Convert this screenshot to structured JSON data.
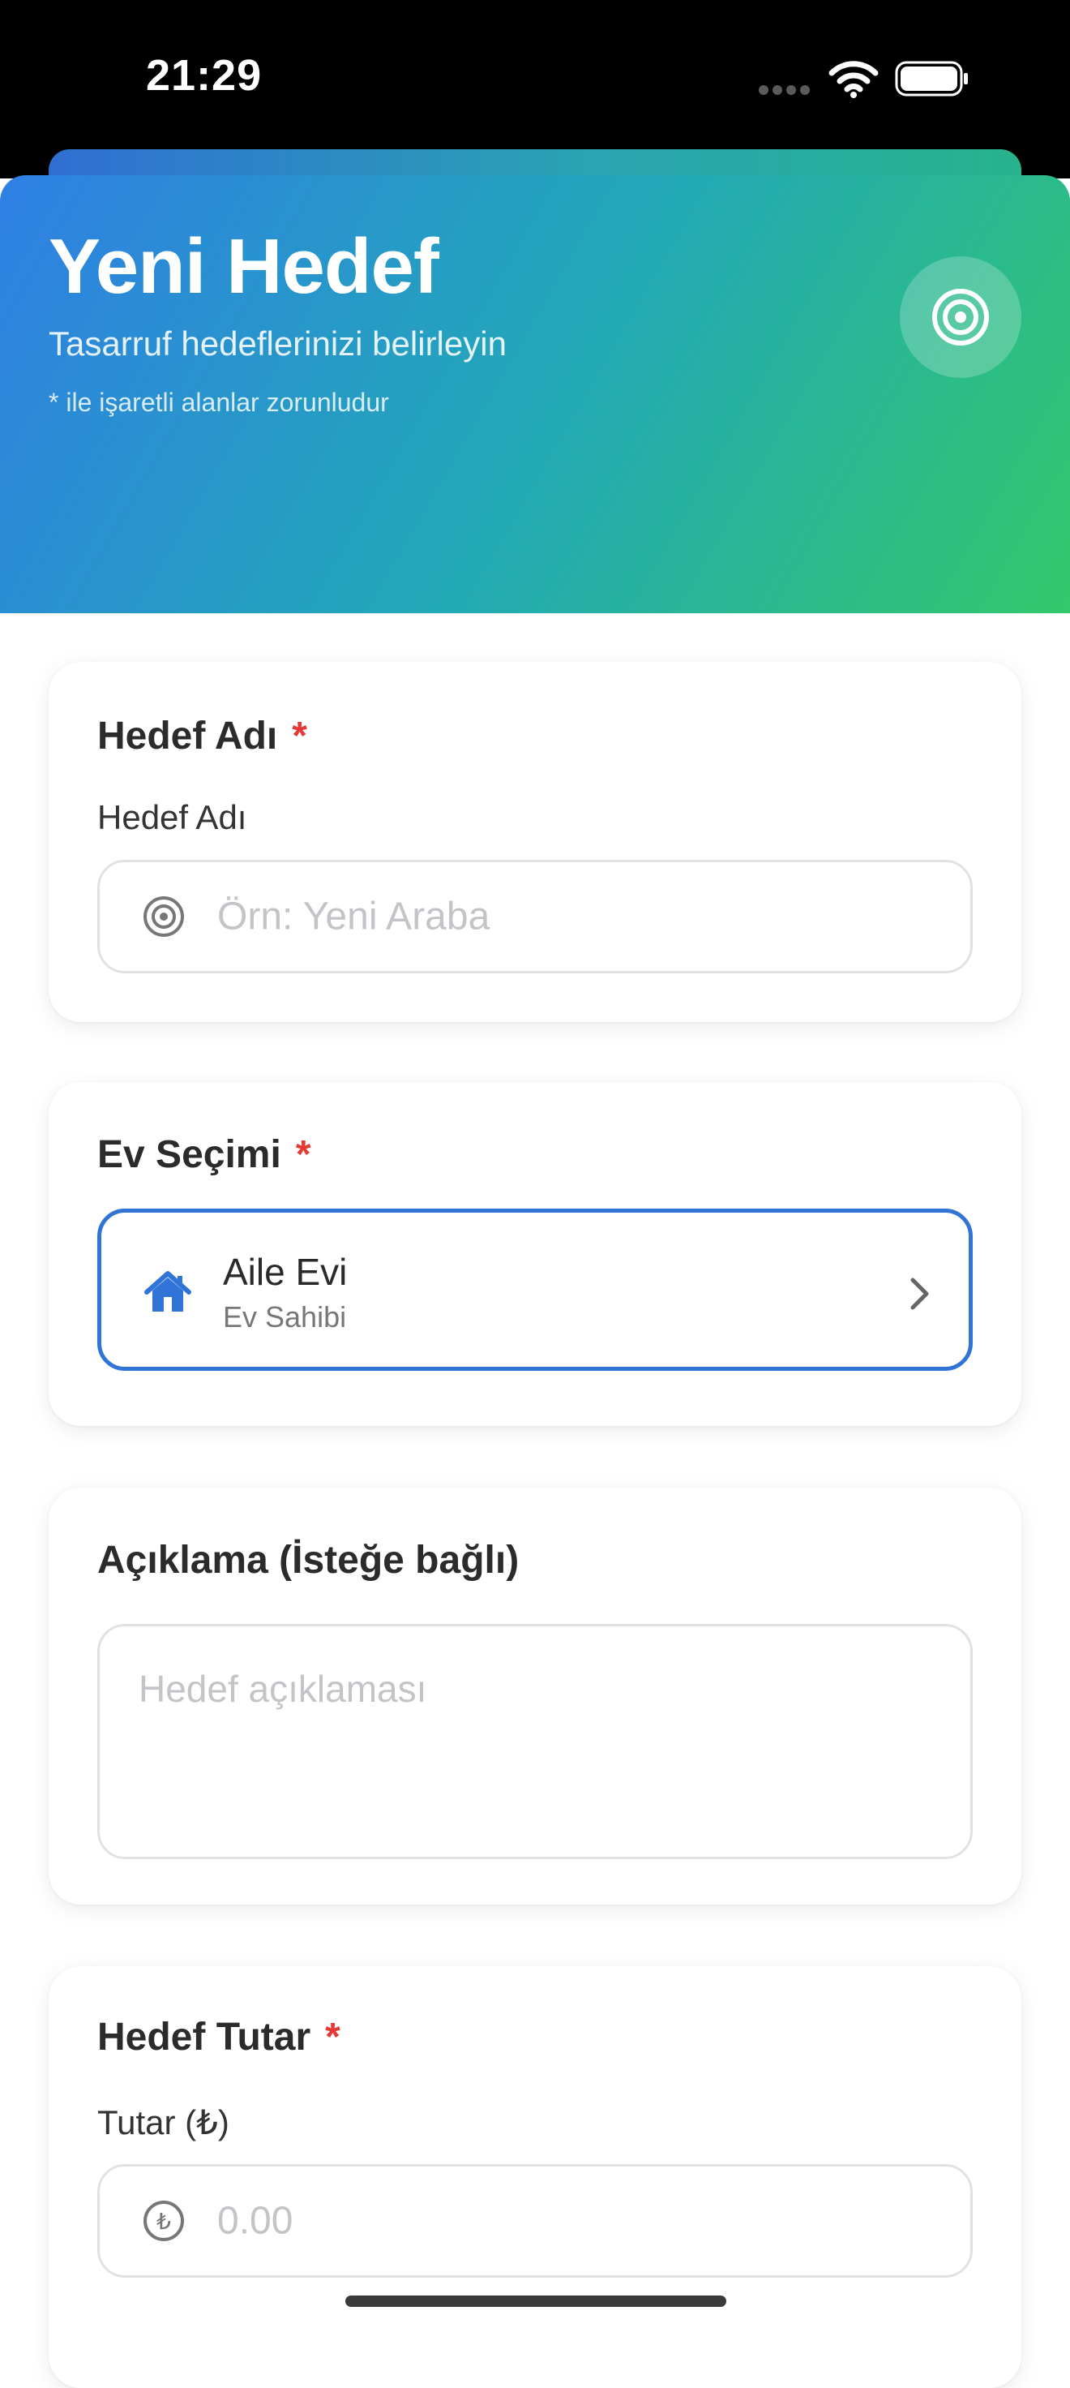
{
  "status_bar": {
    "time": "21:29"
  },
  "header": {
    "title": "Yeni Hedef",
    "subtitle": "Tasarruf hedeflerinizi belirleyin",
    "note": "* ile işaretli alanlar zorunludur",
    "icon": "target-icon"
  },
  "goal_name_card": {
    "title": "Hedef Adı",
    "required_mark": "*",
    "label": "Hedef Adı",
    "placeholder": "Örn: Yeni Araba",
    "icon": "target-icon"
  },
  "house_card": {
    "title": "Ev Seçimi",
    "required_mark": "*",
    "selected_house": {
      "name": "Aile Evi",
      "role": "Ev Sahibi",
      "icon": "home-icon"
    },
    "accent_color": "#2f74d6"
  },
  "description_card": {
    "title": "Açıklama (İsteğe bağlı)",
    "placeholder": "Hedef açıklaması"
  },
  "amount_card": {
    "title": "Hedef Tutar",
    "required_mark": "*",
    "label": "Tutar (₺)",
    "placeholder": "0.00",
    "currency_symbol": "₺",
    "icon": "lira-icon"
  },
  "colors": {
    "header_gradient_start": "#2f7fe4",
    "header_gradient_end": "#32c86b",
    "required": "#e53935"
  }
}
